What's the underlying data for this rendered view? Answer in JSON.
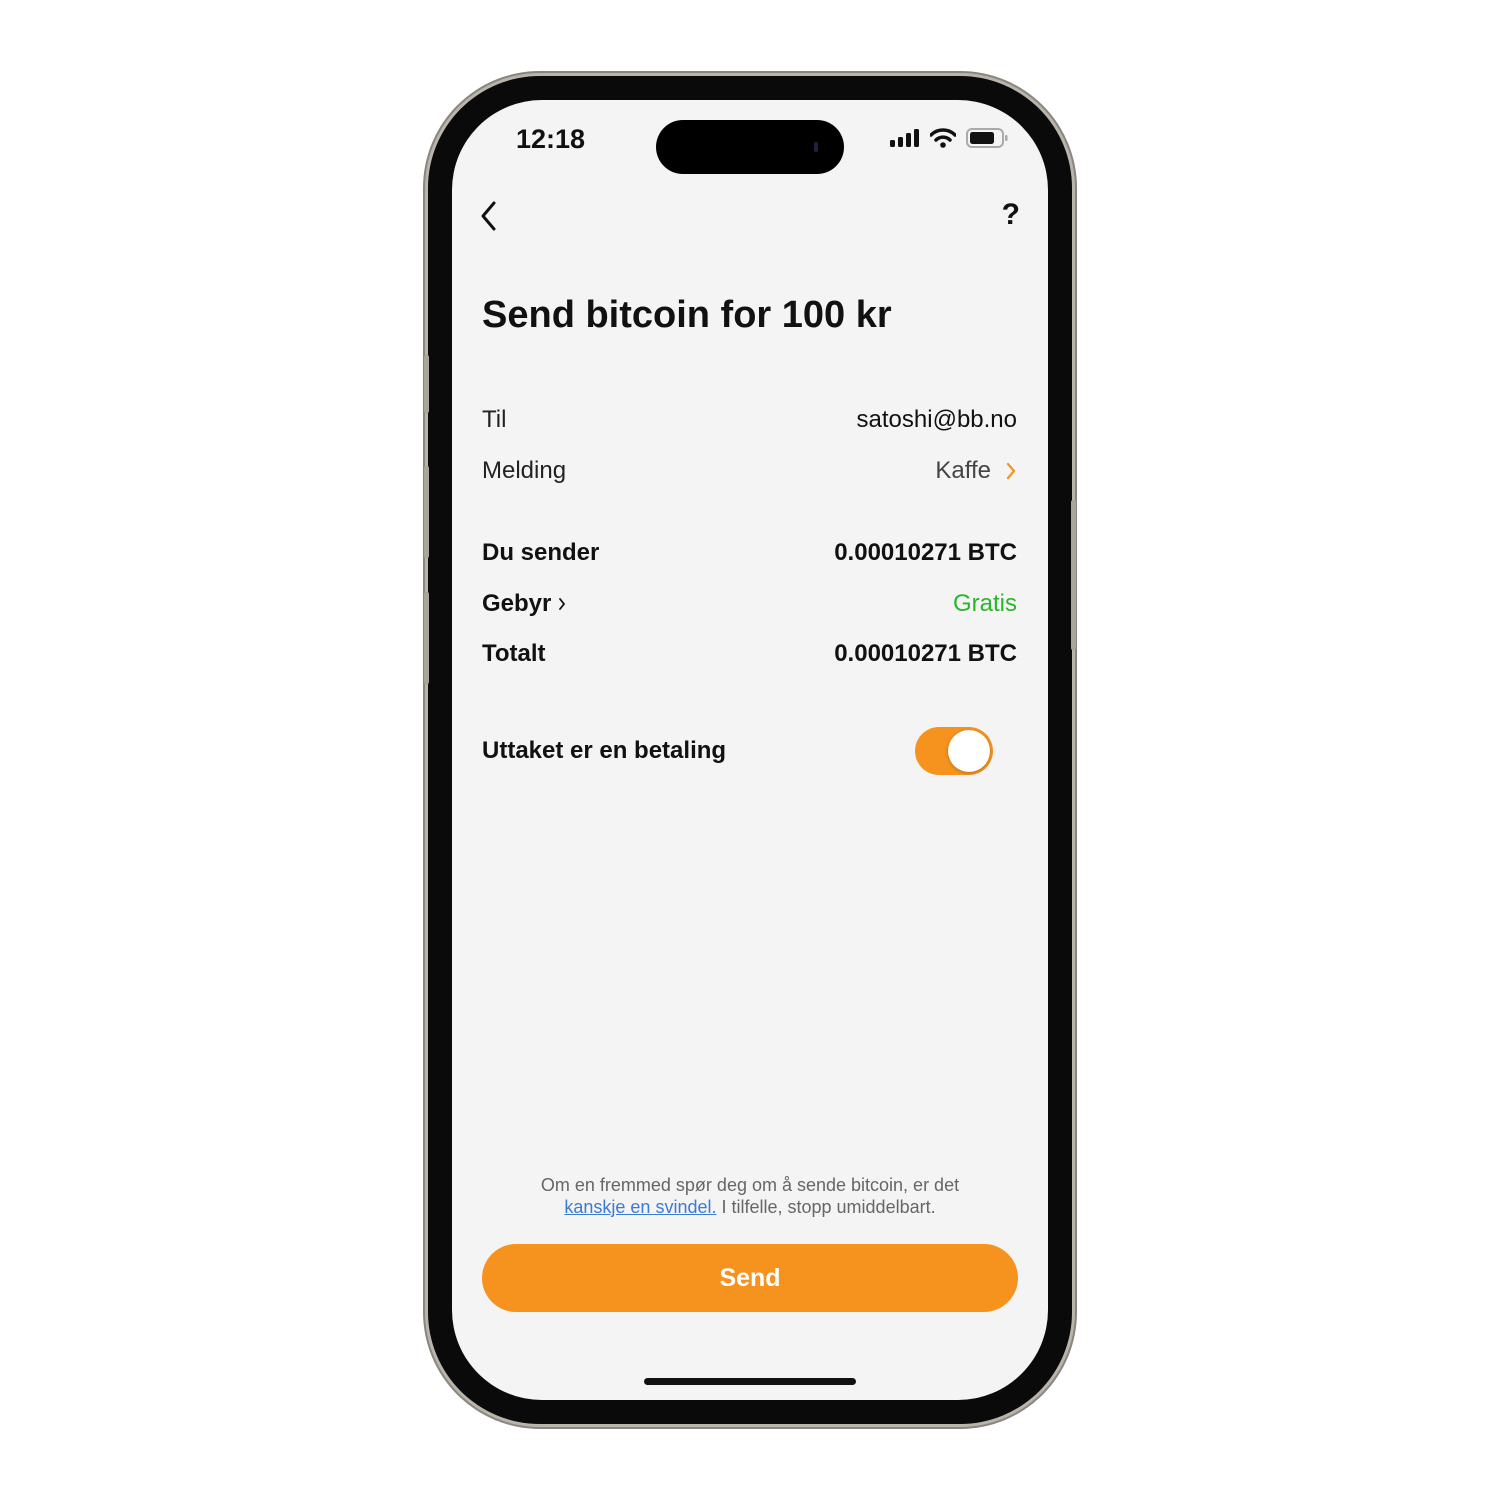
{
  "status_bar": {
    "time": "12:18"
  },
  "nav": {
    "back_icon": "chevron-left-icon",
    "help_label": "?"
  },
  "title": "Send bitcoin for 100 kr",
  "details": {
    "to_label": "Til",
    "to_value": "satoshi@bb.no",
    "message_label": "Melding",
    "message_value": "Kaffe",
    "sending_label": "Du sender",
    "sending_value": "0.00010271 BTC",
    "fee_label": "Gebyr",
    "fee_value": "Gratis",
    "total_label": "Totalt",
    "total_value": "0.00010271 BTC"
  },
  "payment_toggle": {
    "label": "Uttaket er en betaling",
    "on": true
  },
  "warning": {
    "text_before": "Om en fremmed spør deg om å sende bitcoin, er det",
    "link": "kanskje en svindel.",
    "text_after": " I tilfelle, stopp umiddelbart."
  },
  "send_label": "Send",
  "colors": {
    "accent": "#f6921e",
    "free": "#2bb52b",
    "link": "#3a7bd5"
  }
}
